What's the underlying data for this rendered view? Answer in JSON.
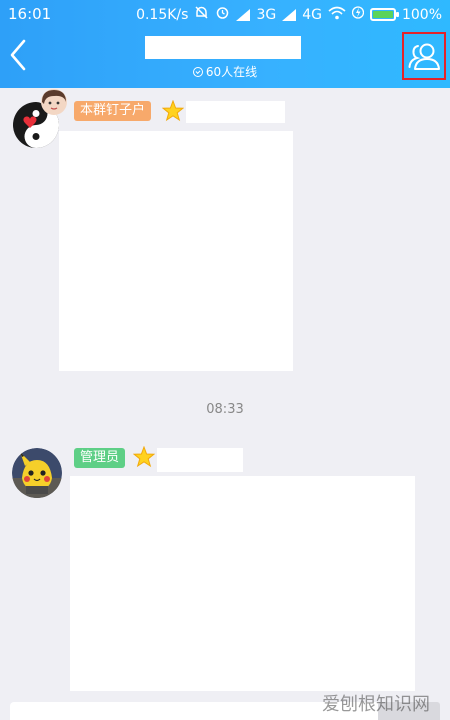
{
  "status_bar": {
    "time": "16:01",
    "net_speed": "0.15K/s",
    "network_3g": "3G",
    "network_4g": "4G",
    "battery": "100%"
  },
  "header": {
    "online_count": "60人在线"
  },
  "messages": [
    {
      "role_tag": "本群钉子户",
      "tag_color": "#f7a96b"
    },
    {
      "role_tag": "管理员",
      "tag_color": "#5ecf86"
    }
  ],
  "timestamp": "08:33",
  "watermark": "爱刨根知识网",
  "colors": {
    "header_start": "#2ea0f8",
    "header_end": "#2fb9ff",
    "highlight_box": "#e4232a",
    "background": "#efeff4"
  }
}
